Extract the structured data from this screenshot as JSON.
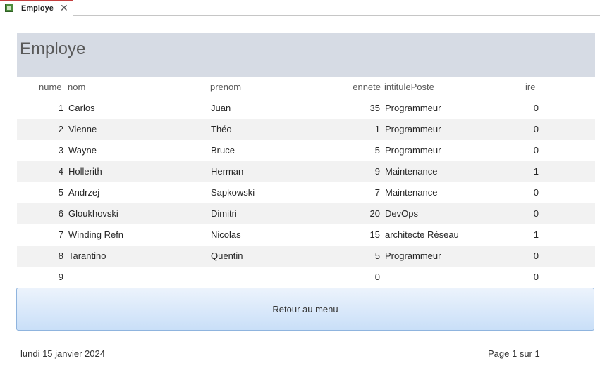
{
  "tab": {
    "label": "Employe",
    "close": "✕"
  },
  "header": {
    "title": "Employe"
  },
  "columns": {
    "numero": "nume",
    "nom": "nom",
    "prenom": "prenom",
    "anciennete": "ennete",
    "intitulePoste": "intitulePoste",
    "salaire": "ire"
  },
  "rows": [
    {
      "numero": "1",
      "nom": "Carlos",
      "prenom": "Juan",
      "anciennete": "35",
      "intitulePoste": "Programmeur",
      "salaire": "0"
    },
    {
      "numero": "2",
      "nom": "Vienne",
      "prenom": "Théo",
      "anciennete": "1",
      "intitulePoste": "Programmeur",
      "salaire": "0"
    },
    {
      "numero": "3",
      "nom": "Wayne",
      "prenom": "Bruce",
      "anciennete": "5",
      "intitulePoste": "Programmeur",
      "salaire": "0"
    },
    {
      "numero": "4",
      "nom": "Hollerith",
      "prenom": "Herman",
      "anciennete": "9",
      "intitulePoste": "Maintenance",
      "salaire": "1"
    },
    {
      "numero": "5",
      "nom": "Andrzej",
      "prenom": "Sapkowski",
      "anciennete": "7",
      "intitulePoste": "Maintenance",
      "salaire": "0"
    },
    {
      "numero": "6",
      "nom": "Gloukhovski",
      "prenom": "Dimitri",
      "anciennete": "20",
      "intitulePoste": "DevOps",
      "salaire": "0"
    },
    {
      "numero": "7",
      "nom": "Winding Refn",
      "prenom": "Nicolas",
      "anciennete": "15",
      "intitulePoste": "architecte  Réseau",
      "salaire": "1"
    },
    {
      "numero": "8",
      "nom": "Tarantino",
      "prenom": "Quentin",
      "anciennete": "5",
      "intitulePoste": "Programmeur",
      "salaire": "0"
    },
    {
      "numero": "9",
      "nom": "",
      "prenom": "",
      "anciennete": "0",
      "intitulePoste": "",
      "salaire": "0"
    }
  ],
  "button": {
    "label": "Retour au menu"
  },
  "footer": {
    "date": "lundi 15 janvier 2024",
    "page": "Page 1 sur 1"
  }
}
